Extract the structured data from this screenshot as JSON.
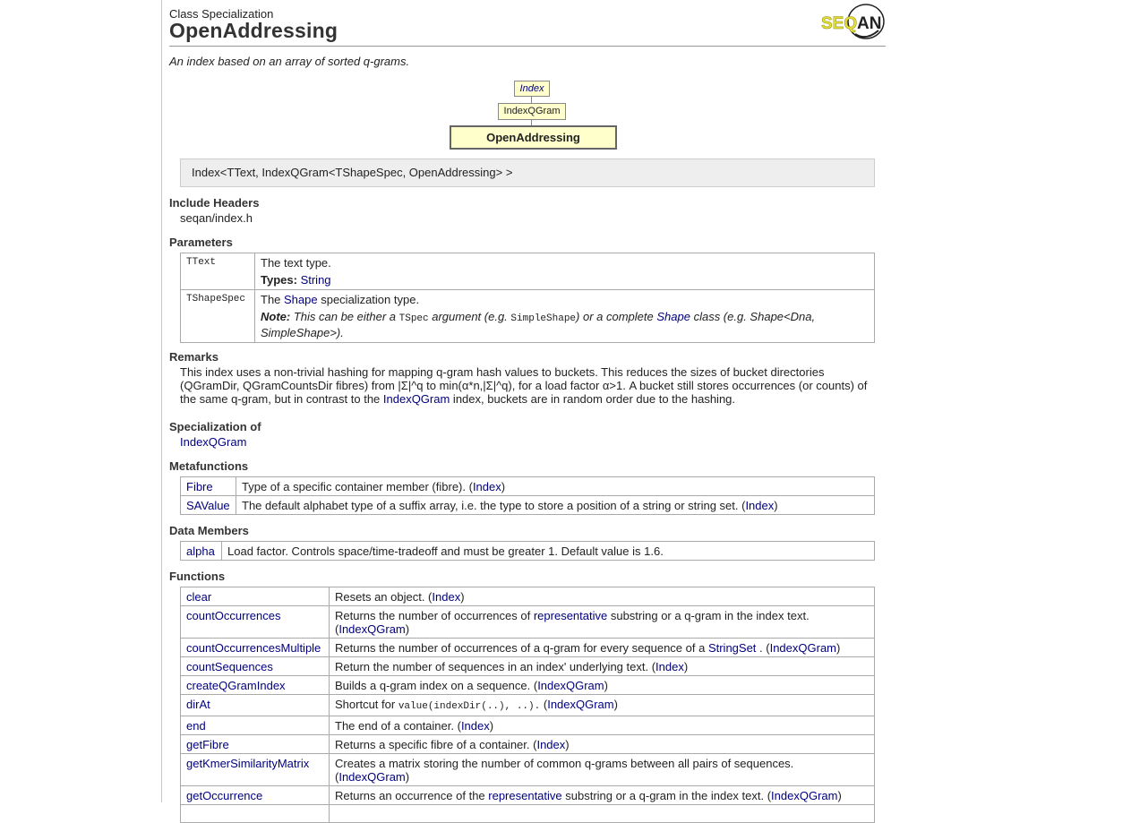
{
  "header": {
    "kind": "Class Specialization",
    "title": "OpenAddressing",
    "summary": "An index based on an array of sorted q-grams.",
    "logo_text": "SEQAN"
  },
  "hierarchy": [
    "Index",
    "IndexQGram",
    "OpenAddressing"
  ],
  "signature": "Index<TText, IndexQGram<TShapeSpec, OpenAddressing> >",
  "include": {
    "heading": "Include Headers",
    "file": "seqan/index.h"
  },
  "parameters": {
    "heading": "Parameters",
    "rows": [
      {
        "name": "TText",
        "desc": "The text type.",
        "types_label": "Types:",
        "types_link": "String"
      },
      {
        "name": "TShapeSpec",
        "desc_pre": "The ",
        "desc_link": "Shape",
        "desc_post": " specialization type.",
        "note_label": "Note:",
        "note_1": " This can be either a ",
        "note_code1": "TSpec",
        "note_2": " argument (e.g. ",
        "note_code2": "SimpleShape",
        "note_3": ") or a complete ",
        "note_link": "Shape",
        "note_4": " class (e.g. Shape<Dna, SimpleShape>)."
      }
    ]
  },
  "remarks": {
    "heading": "Remarks",
    "text_pre": "This index uses a non-trivial hashing for mapping q-gram hash values to buckets. This reduces the sizes of bucket directories (QGramDir, QGramCountsDir fibres) from |Σ|^q to min(α*n,|Σ|^q), for a load factor α>1. A bucket still stores occurrences (or counts) of the same q-gram, but in contrast to the ",
    "text_link": "IndexQGram",
    "text_post": " index, buckets are in random order due to the hashing."
  },
  "specialization_of": {
    "heading": "Specialization of",
    "link": "IndexQGram"
  },
  "metafunctions": {
    "heading": "Metafunctions",
    "rows": [
      {
        "name": "Fibre",
        "desc": "Type of a specific container member (fibre). (",
        "ref": "Index",
        "end": ")"
      },
      {
        "name": "SAValue",
        "desc": "The default alphabet type of a suffix array, i.e. the type to store a position of a string or string set. (",
        "ref": "Index",
        "end": ")"
      }
    ]
  },
  "data_members": {
    "heading": "Data Members",
    "rows": [
      {
        "name": "alpha",
        "desc": "Load factor. Controls space/time-tradeoff and must be greater 1. Default value is 1.6."
      }
    ]
  },
  "functions": {
    "heading": "Functions",
    "rows": [
      {
        "name": "clear",
        "d1": "Resets an object. (",
        "ref": "Index",
        "d2": ")"
      },
      {
        "name": "countOccurrences",
        "d1": "Returns the number of occurrences of ",
        "link": "representative",
        "d1b": " substring or a q-gram in the index text. (",
        "ref": "IndexQGram",
        "d2": ")"
      },
      {
        "name": "countOccurrencesMultiple",
        "d1": "Returns the number of occurrences of a q-gram for every sequence of a ",
        "link": "StringSet",
        "d1b": " . (",
        "ref": "IndexQGram",
        "d2": ")"
      },
      {
        "name": "countSequences",
        "d1": "Return the number of sequences in an index' underlying text. (",
        "ref": "Index",
        "d2": ")"
      },
      {
        "name": "createQGramIndex",
        "d1": "Builds a q-gram index on a sequence. (",
        "ref": "IndexQGram",
        "d2": ")"
      },
      {
        "name": "dirAt",
        "d1": "Shortcut for ",
        "code": "value(indexDir(..), ..).",
        "d1b": " (",
        "ref": "IndexQGram",
        "d2": ")"
      },
      {
        "name": "end",
        "d1": "The end of a container. (",
        "ref": "Index",
        "d2": ")"
      },
      {
        "name": "getFibre",
        "d1": "Returns a specific fibre of a container. (",
        "ref": "Index",
        "d2": ")"
      },
      {
        "name": "getKmerSimilarityMatrix",
        "d1": "Creates a matrix storing the number of common q-grams between all pairs of sequences. (",
        "ref": "IndexQGram",
        "d2": ")"
      },
      {
        "name": "getOccurrence",
        "d1": "Returns an occurrence of the ",
        "link": "representative",
        "d1b": " substring or a q-gram in the index text. (",
        "ref": "IndexQGram",
        "d2": ")"
      }
    ]
  }
}
